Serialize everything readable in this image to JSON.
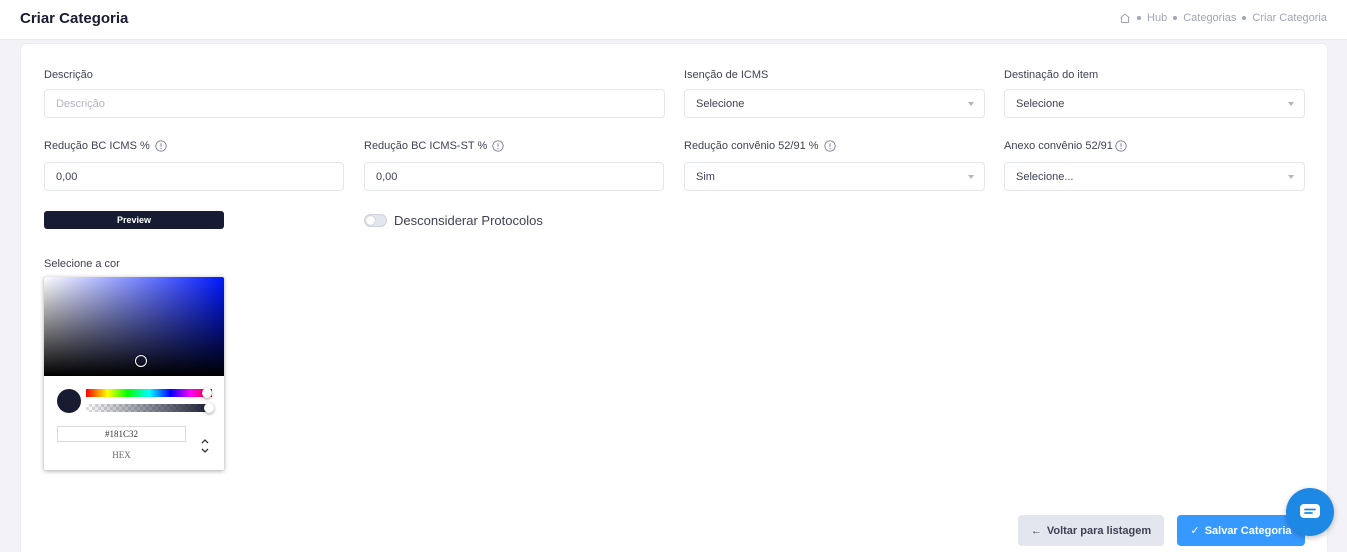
{
  "header": {
    "title": "Criar Categoria",
    "breadcrumb": [
      "Hub",
      "Categorias",
      "Criar Categoria"
    ]
  },
  "form": {
    "descricao": {
      "label": "Descrição",
      "placeholder": "Descrição"
    },
    "isencao_icms": {
      "label": "Isenção de ICMS",
      "value": "Selecione"
    },
    "destinacao": {
      "label": "Destinação do item",
      "value": "Selecione"
    },
    "reducao_bc_icms": {
      "label": "Redução BC ICMS %",
      "value": "0,00"
    },
    "reducao_bc_icms_st": {
      "label": "Redução BC ICMS-ST %",
      "value": "0,00"
    },
    "reducao_convenio": {
      "label": "Redução convênio 52/91 %",
      "value": "Sim"
    },
    "anexo_convenio": {
      "label": "Anexo convênio 52/91",
      "value": "Selecione..."
    },
    "preview_label": "Preview",
    "desconsiderar_label": "Desconsiderar Protocolos",
    "desconsiderar_on": false,
    "cor_label": "Selecione a cor"
  },
  "color_picker": {
    "hex": "#181C32",
    "mode_label": "HEX",
    "current_color": "#181c32",
    "hue_color": "#0018ff",
    "hue_fraction": 0.63,
    "alpha": 1.0
  },
  "actions": {
    "back_label": "Voltar para listagem",
    "save_label": "Salvar Categoria"
  },
  "colors": {
    "primary": "#3699ff",
    "dark": "#181c32",
    "muted": "#e4e6ef"
  },
  "icons": {
    "home": "home-icon",
    "info": "info-circle-icon",
    "back": "arrow-left-icon",
    "save": "check-icon",
    "chat": "chat-icon"
  }
}
